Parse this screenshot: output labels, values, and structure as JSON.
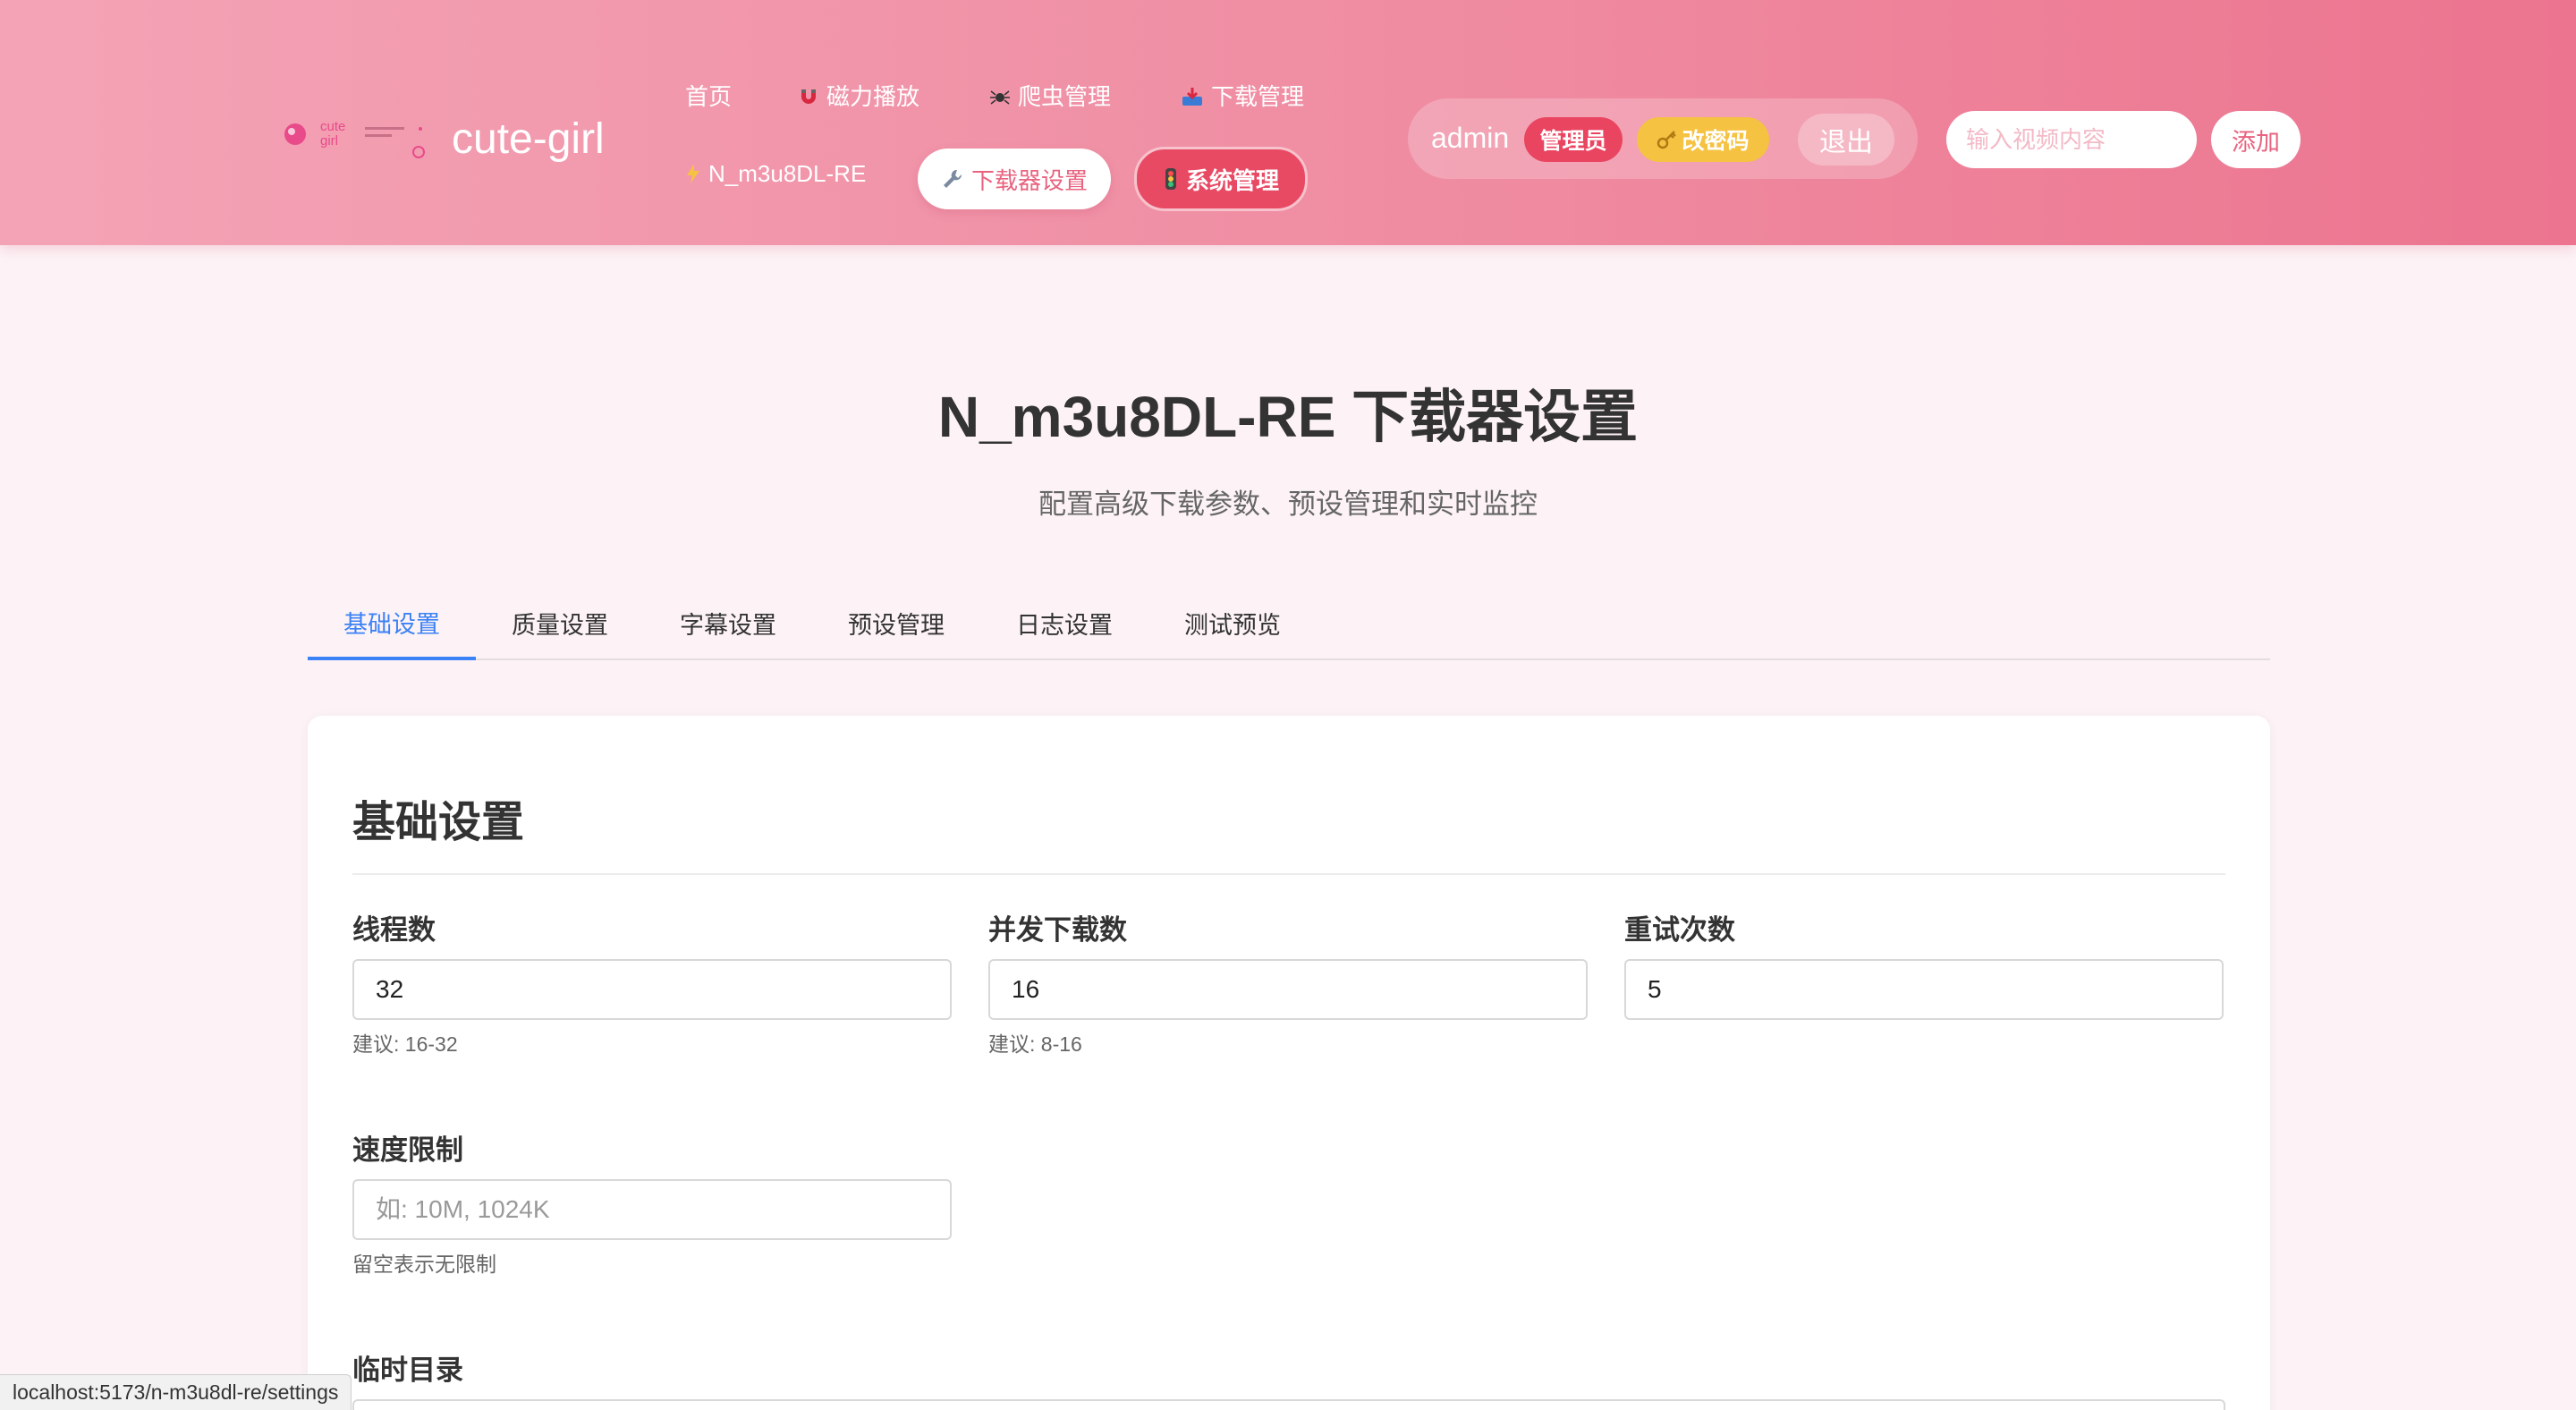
{
  "header": {
    "brand": "cute-girl",
    "nav": {
      "home": "首页",
      "magnet": "磁力播放",
      "crawler": "爬虫管理",
      "download": "下载管理",
      "nm3u8": "N_m3u8DL-RE",
      "downloader_settings": "下载器设置",
      "system": "系统管理"
    },
    "user": {
      "name": "admin",
      "role": "管理员",
      "change_password": "改密码",
      "logout": "退出"
    },
    "search_placeholder": "输入视频内容",
    "add_label": "添加"
  },
  "page": {
    "title": "N_m3u8DL-RE 下载器设置",
    "subtitle": "配置高级下载参数、预设管理和实时监控"
  },
  "tabs": [
    "基础设置",
    "质量设置",
    "字幕设置",
    "预设管理",
    "日志设置",
    "测试预览"
  ],
  "section": {
    "title": "基础设置",
    "fields": {
      "threads": {
        "label": "线程数",
        "value": "32",
        "hint": "建议: 16-32"
      },
      "concurrent": {
        "label": "并发下载数",
        "value": "16",
        "hint": "建议: 8-16"
      },
      "retry": {
        "label": "重试次数",
        "value": "5"
      },
      "speed_limit": {
        "label": "速度限制",
        "value": "",
        "placeholder": "如: 10M, 1024K",
        "hint": "留空表示无限制"
      },
      "temp_dir": {
        "label": "临时目录"
      }
    }
  },
  "statusbar": {
    "url": "localhost:5173/n-m3u8dl-re/settings"
  },
  "colors": {
    "header_start": "#f4a3b6",
    "header_end": "#ec748f",
    "accent_blue": "#3b82f6",
    "admin_badge": "#e94560",
    "password_badge": "#f5c242",
    "page_bg": "#fdf3f6"
  }
}
